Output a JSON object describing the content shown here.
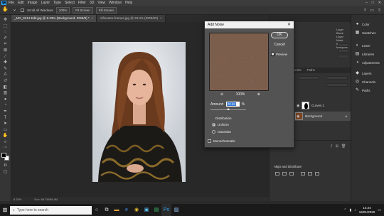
{
  "menubar": {
    "logo": "Ps",
    "items": [
      "File",
      "Edit",
      "Image",
      "Layer",
      "Type",
      "Select",
      "Filter",
      "3D",
      "View",
      "Window",
      "Help"
    ],
    "window_controls": [
      "–",
      "□",
      "✕"
    ]
  },
  "options_bar": {
    "scroll_all_windows": "Scroll All Windows",
    "zoom_value": "100%",
    "fit_screen": "Fit Screen",
    "fill_screen": "Fill Screen"
  },
  "tabs": [
    {
      "label": "_MG_9214 Edit.jpg @ 8.33% (Background, RGB/8) *",
      "active": true
    },
    {
      "label": "clifionatre-frames.jpg @ 33.3% (RGB/8#)",
      "active": false
    }
  ],
  "status": {
    "zoom": "8.33%",
    "doc_size": "Doc: 66.7M/65.4M"
  },
  "dialog": {
    "title": "Add Noise",
    "ok": "OK",
    "cancel": "Cancel",
    "preview_label": "Preview",
    "zoom_level": "100%",
    "zoom_out": "⊖",
    "zoom_in": "⊕",
    "amount_label": "Amount:",
    "amount_value": "22.34",
    "amount_unit": "%",
    "distribution_label": "Distribution",
    "uniform": "Uniform",
    "gaussian": "Gaussian",
    "monochromatic": "Monochromatic"
  },
  "panels": {
    "top_lines": [
      "Layer Black",
      "Layer Mask",
      "Mask Marquee"
    ],
    "layer_tabs": [
      "Layers",
      "Channels",
      "Paths"
    ],
    "layers": [
      {
        "name": "Curves 1",
        "selected": false
      },
      {
        "name": "Background",
        "selected": true
      }
    ],
    "align_title": "Align and Distribute"
  },
  "side_column": [
    {
      "icon": "●",
      "label": "Color"
    },
    {
      "icon": "▦",
      "label": "Swatches"
    },
    {
      "icon": "◐",
      "label": "Learn"
    },
    {
      "icon": "▤",
      "label": "Libraries"
    },
    {
      "icon": "◑",
      "label": "Adjustments"
    },
    {
      "icon": "◆",
      "label": "Layers"
    },
    {
      "icon": "◎",
      "label": "Channels"
    },
    {
      "icon": "✎",
      "label": "Paths"
    }
  ],
  "taskbar": {
    "search_placeholder": "Type here to search",
    "time": "14:24",
    "date": "16/01/2020"
  },
  "colors": {
    "accent": "#31a8ff",
    "selection_highlight": "#3478d8"
  }
}
